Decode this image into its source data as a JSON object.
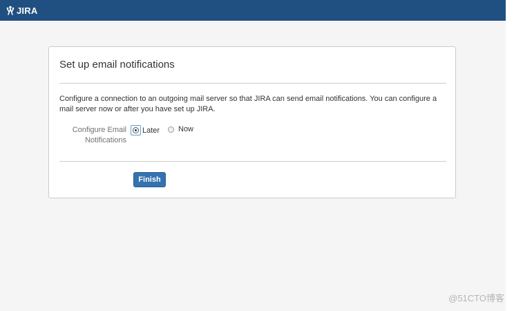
{
  "header": {
    "logo_text": "JIRA",
    "logo_icon": "jira-logo-icon",
    "background_color": "#205081"
  },
  "card": {
    "title": "Set up email notifications",
    "description": "Configure a connection to an outgoing mail server so that JIRA can send email notifications. You can configure a mail server now or after you have set up JIRA.",
    "field_label": "Configure Email Notifications",
    "options": [
      {
        "label": "Later",
        "selected": true
      },
      {
        "label": "Now",
        "selected": false
      }
    ],
    "finish_label": "Finish",
    "button_color": "#3572b0"
  },
  "watermark": "@51CTO博客"
}
